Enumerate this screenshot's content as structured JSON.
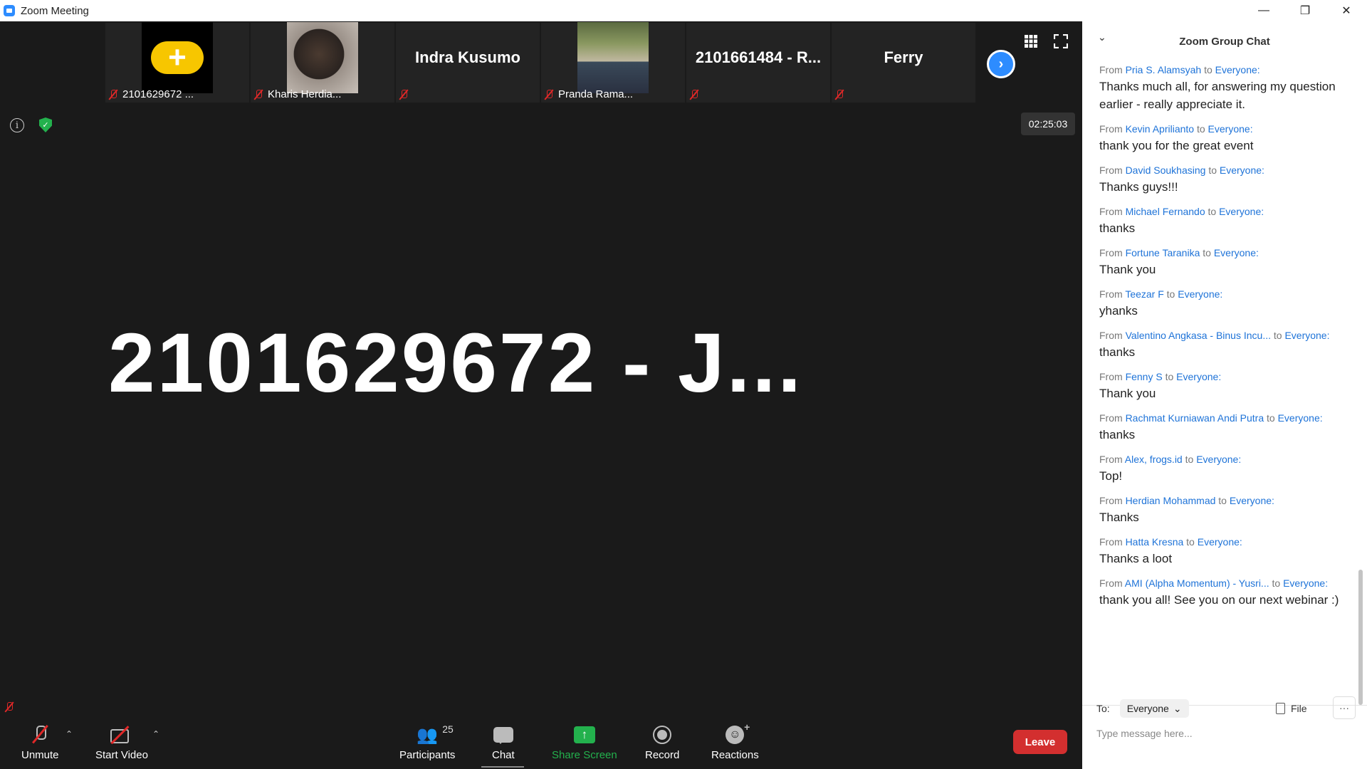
{
  "window": {
    "title": "Zoom Meeting",
    "controls": [
      "—",
      "❐",
      "✕"
    ]
  },
  "strip": {
    "tiles": [
      {
        "label": "2101629672 ...",
        "big_name": ""
      },
      {
        "label": "Kharis Herdia...",
        "big_name": ""
      },
      {
        "label": "",
        "big_name": "Indra Kusumo"
      },
      {
        "label": "Pranda Rama...",
        "big_name": ""
      },
      {
        "label": "",
        "big_name": "2101661484 - R..."
      },
      {
        "label": "",
        "big_name": "Ferry"
      }
    ],
    "next_icon": "›"
  },
  "meeting": {
    "timer": "02:25:03",
    "active_speaker": "2101629672 - J..."
  },
  "toolbar": {
    "unmute_label": "Unmute",
    "start_video_label": "Start Video",
    "participants_label": "Participants",
    "participants_count": "25",
    "chat_label": "Chat",
    "share_label": "Share Screen",
    "record_label": "Record",
    "reactions_label": "Reactions",
    "leave_label": "Leave",
    "share_color": "#23b14d",
    "leave_color": "#d32f2f"
  },
  "chat": {
    "title": "Zoom Group Chat",
    "messages": [
      {
        "from": "Pria S. Alamsyah",
        "to": "Everyone:",
        "text": "Thanks much all, for answering my question earlier - really appreciate it."
      },
      {
        "from": "Kevin Aprilianto",
        "to": "Everyone:",
        "text": "thank you for the great event"
      },
      {
        "from": "David Soukhasing",
        "to": "Everyone:",
        "text": "Thanks guys!!!"
      },
      {
        "from": "Michael Fernando",
        "to": "Everyone:",
        "text": "thanks"
      },
      {
        "from": "Fortune Taranika",
        "to": "Everyone:",
        "text": "Thank you"
      },
      {
        "from": "Teezar F",
        "to": "Everyone:",
        "text": "yhanks"
      },
      {
        "from": "Valentino Angkasa - Binus Incu...",
        "to": "Everyone:",
        "text": "thanks"
      },
      {
        "from": "Fenny S",
        "to": "Everyone:",
        "text": "Thank you"
      },
      {
        "from": "Rachmat Kurniawan Andi Putra",
        "to": "Everyone:",
        "text": "thanks"
      },
      {
        "from": "Alex, frogs.id",
        "to": "Everyone:",
        "text": "Top!"
      },
      {
        "from": "Herdian Mohammad",
        "to": "Everyone:",
        "text": "Thanks"
      },
      {
        "from": "Hatta Kresna",
        "to": "Everyone:",
        "text": "Thanks a loot"
      },
      {
        "from": "AMI (Alpha Momentum) - Yusri...",
        "to": "Everyone:",
        "text": "thank you all! See you on our next webinar :)"
      }
    ],
    "from_word": "From",
    "to_word": "to",
    "to_label": "To:",
    "recipient": "Everyone",
    "file_label": "File",
    "more_label": "···",
    "input_placeholder": "Type message here..."
  }
}
